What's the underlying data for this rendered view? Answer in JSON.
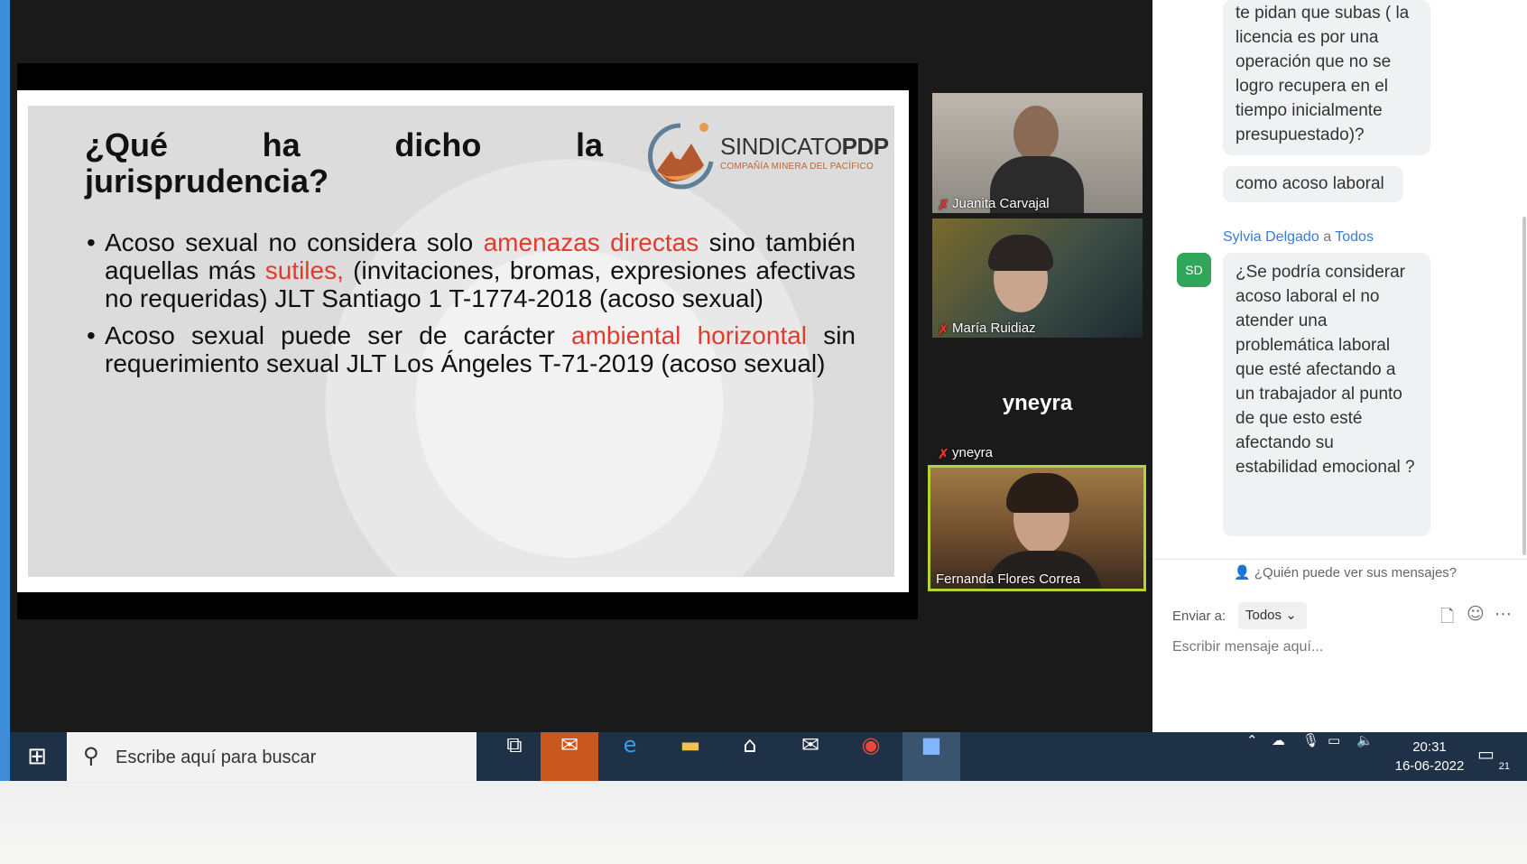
{
  "slide": {
    "title_words": [
      "¿Qué",
      "ha",
      "dicho",
      "la"
    ],
    "title_line2": "jurisprudencia?",
    "logo_main": "SINDICATO",
    "logo_bold": "PDP",
    "logo_sub": "COMPAÑÍA MINERA DEL PACÍFICO",
    "bullet1": {
      "a": "Acoso sexual no considera solo ",
      "r1": "amenazas directas",
      "b": " sino también aquellas más ",
      "r2": "sutiles,",
      "c": " (invitaciones, bromas, expresiones afectivas no requeridas) JLT Santiago 1 T-1774-2018 (acoso sexual)"
    },
    "bullet2": {
      "a": "Acoso sexual puede ser de carácter ",
      "r1": "ambiental horizontal",
      "b": " sin requerimiento sexual JLT Los Ángeles T-71-2019  (acoso sexual)"
    }
  },
  "participants": [
    {
      "name": "Juanita Carvajal"
    },
    {
      "name": "María Ruidiaz"
    },
    {
      "name": "yneyra",
      "display": "yneyra"
    },
    {
      "name": "Fernanda Flores Correa"
    }
  ],
  "chat": {
    "msg1": "te pidan que subas ( la licencia es por una operación que no se logro recupera en el tiempo inicialmente presupuestado)?",
    "msg2": "como acoso laboral",
    "sender": "Sylvia Delgado",
    "to_word": "a",
    "recipient": "Todos",
    "avatar": "SD",
    "msg3": "¿Se podría considerar acoso laboral el no atender una problemática laboral que esté afectando a un trabajador al punto de que esto esté afectando su estabilidad emocional ?",
    "who_can_see": "¿Quién puede ver sus mensajes?",
    "send_to_label": "Enviar a:",
    "send_to_value": "Todos",
    "compose_placeholder": "Escribir mensaje aquí..."
  },
  "taskbar": {
    "search_placeholder": "Escribe aquí para buscar",
    "time": "20:31",
    "date": "16-06-2022",
    "notif_count": "21"
  },
  "colors": {
    "accent_red": "#e23b2e",
    "active_speaker": "#b4d334",
    "taskbar": "#1f3147",
    "chat_link": "#3b7bd6"
  }
}
